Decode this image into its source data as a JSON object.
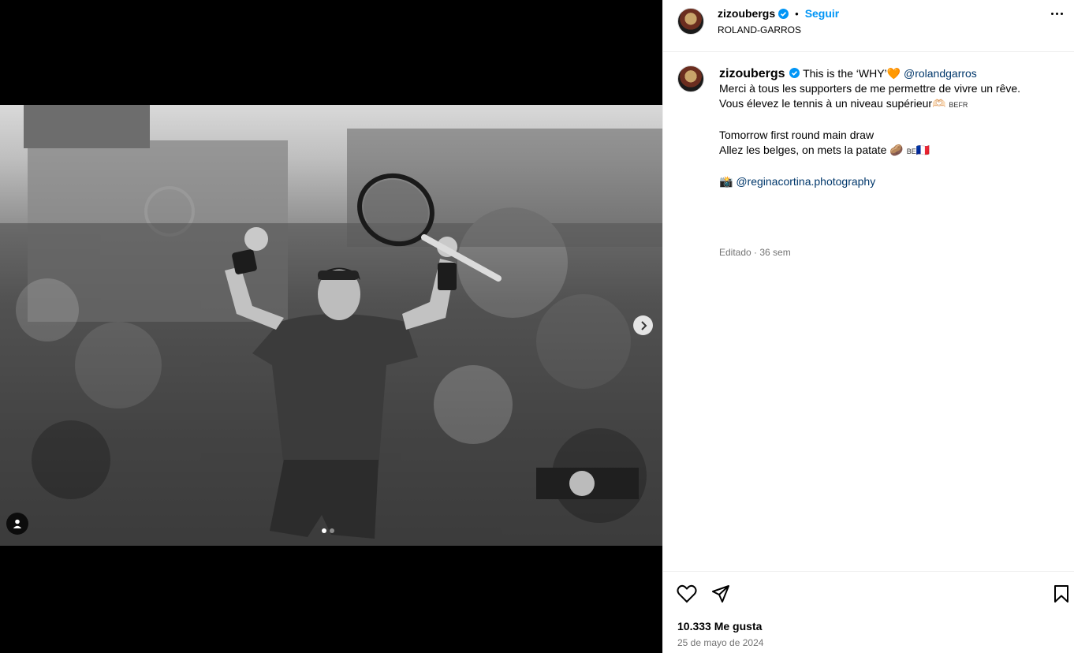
{
  "post": {
    "username": "zizoubergs",
    "follow_label": "Seguir",
    "separator": "•",
    "location": "ROLAND-GARROS"
  },
  "caption": {
    "username": "zizoubergs",
    "line1_text": "This is the ‘WHY’",
    "line1_emoji": "🧡",
    "line1_mention": "@rolandgarros",
    "line2": "Merci à tous les supporters de me permettre de vivre un rêve.",
    "line3_text": "Vous élevez le tennis à un niveau supérieur",
    "line3_emoji": "🫶🏻",
    "line3_flags": "BEFR",
    "line4": "Tomorrow first round main draw",
    "line5_text": "Allez les belges, on mets la patate",
    "line5_emoji": "🥔",
    "line5_flags": "BE",
    "line5_emoji2": "🇫🇷",
    "credit_emoji": "📸",
    "credit_mention": "@reginacortina.photography",
    "edited": "Editado",
    "time_ago": "36 sem"
  },
  "actions": {
    "likes": "10.333 Me gusta",
    "date": "25 de mayo de 2024"
  },
  "carousel": {
    "slide_count": 2,
    "active_index": 0
  },
  "colors": {
    "link_blue": "#0095f6",
    "mention_blue": "#00376b",
    "verified_blue": "#0095f6",
    "muted_gray": "#737373"
  },
  "icons": [
    "verified-badge-icon",
    "more-options-icon",
    "heart-icon",
    "share-icon",
    "bookmark-icon",
    "chevron-right-icon",
    "user-tag-icon"
  ]
}
